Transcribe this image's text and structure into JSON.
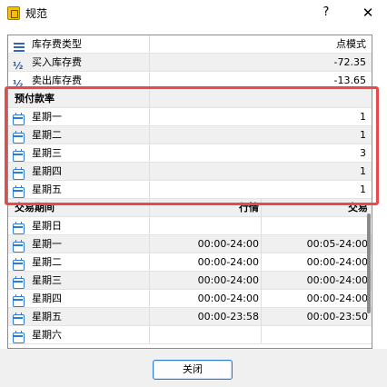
{
  "window": {
    "title": "规范",
    "help": "?",
    "close": "✕"
  },
  "rows": [
    {
      "icon": "list-icon",
      "label": "库存费类型",
      "value": "点模式",
      "alt": false
    },
    {
      "icon": "half-icon",
      "label": "买入库存费",
      "value": "-72.35",
      "alt": true
    },
    {
      "icon": "half-icon",
      "label": "卖出库存费",
      "value": "-13.65",
      "alt": false
    },
    {
      "header": true,
      "label": "预付款率",
      "value": "",
      "alt": true
    },
    {
      "icon": "calendar-icon",
      "label": "星期一",
      "value": "1",
      "alt": false
    },
    {
      "icon": "calendar-icon",
      "label": "星期二",
      "value": "1",
      "alt": true
    },
    {
      "icon": "calendar-icon",
      "label": "星期三",
      "value": "3",
      "alt": false
    },
    {
      "icon": "calendar-icon",
      "label": "星期四",
      "value": "1",
      "alt": true
    },
    {
      "icon": "calendar-icon",
      "label": "星期五",
      "value": "1",
      "alt": false
    },
    {
      "header": true,
      "label": "交易期间",
      "quote": "行情",
      "trade": "交易",
      "alt": true
    },
    {
      "icon": "calendar-icon",
      "label": "星期日",
      "quote": "",
      "trade": "",
      "alt": false
    },
    {
      "icon": "calendar-icon",
      "label": "星期一",
      "quote": "00:00-24:00",
      "trade": "00:05-24:00",
      "alt": true
    },
    {
      "icon": "calendar-icon",
      "label": "星期二",
      "quote": "00:00-24:00",
      "trade": "00:00-24:00",
      "alt": false
    },
    {
      "icon": "calendar-icon",
      "label": "星期三",
      "quote": "00:00-24:00",
      "trade": "00:00-24:00",
      "alt": true
    },
    {
      "icon": "calendar-icon",
      "label": "星期四",
      "quote": "00:00-24:00",
      "trade": "00:00-24:00",
      "alt": false
    },
    {
      "icon": "calendar-icon",
      "label": "星期五",
      "quote": "00:00-23:58",
      "trade": "00:00-23:50",
      "alt": true
    },
    {
      "icon": "calendar-icon",
      "label": "星期六",
      "quote": "",
      "trade": "",
      "alt": false
    }
  ],
  "footer": {
    "close_label": "关闭"
  },
  "colors": {
    "highlight": "#e8494a",
    "accent": "#2f7dd1"
  }
}
